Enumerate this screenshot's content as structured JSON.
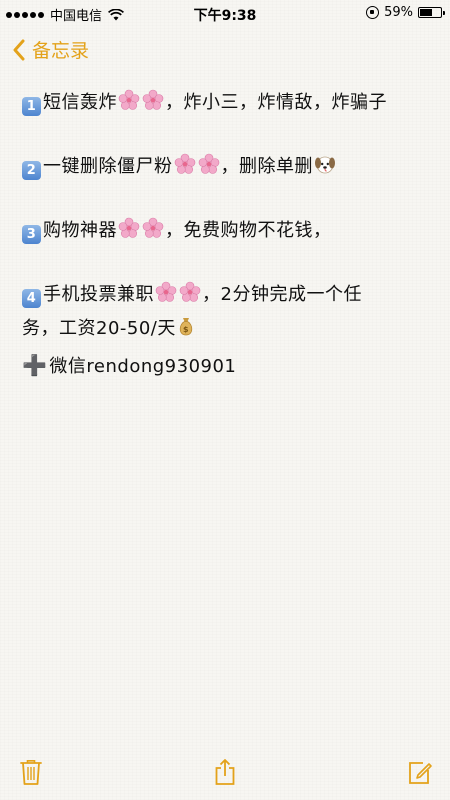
{
  "status_bar": {
    "carrier": "中国电信",
    "time": "下午9:38",
    "battery_text": "59%",
    "battery_level": 0.59
  },
  "nav": {
    "back_label": "备忘录"
  },
  "note": {
    "line1": {
      "num": "1",
      "text": "短信轰炸",
      "tail": "，炸小三，炸情敌，炸骗子"
    },
    "line2": {
      "num": "2",
      "text": "一键删除僵尸粉",
      "tail": "，删除单删"
    },
    "line3": {
      "num": "3",
      "text": "购物神器",
      "tail": "，免费购物不花钱，"
    },
    "line4": {
      "num": "4",
      "text": "手机投票兼职",
      "tail": "，2分钟完成一个任",
      "cont": "务，工资20-50/天"
    },
    "line5": {
      "plus": "➕",
      "text": "微信rendong930901"
    }
  },
  "colors": {
    "accent": "#e3a21a",
    "keycap": "#4d84cf",
    "flower": "#f2a9c9"
  },
  "icons": {
    "back": "chevron-left-icon",
    "trash": "trash-icon",
    "share": "share-icon",
    "compose": "compose-icon"
  }
}
